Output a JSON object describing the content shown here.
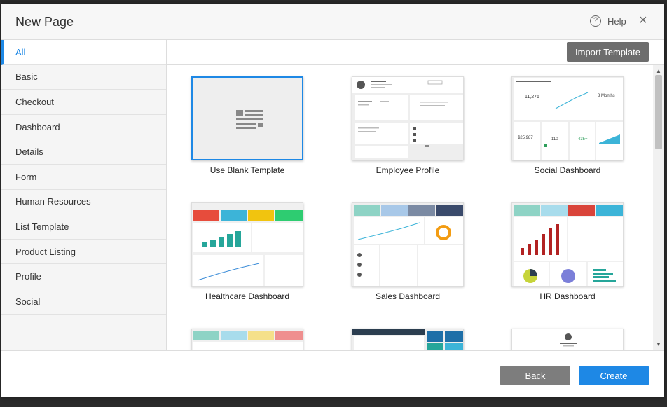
{
  "header": {
    "title": "New Page",
    "help_label": "Help",
    "help_icon": "?",
    "close_icon": "×"
  },
  "sidebar": {
    "items": [
      {
        "label": "All",
        "active": true
      },
      {
        "label": "Basic"
      },
      {
        "label": "Checkout"
      },
      {
        "label": "Dashboard"
      },
      {
        "label": "Details"
      },
      {
        "label": "Form"
      },
      {
        "label": "Human Resources"
      },
      {
        "label": "List Template"
      },
      {
        "label": "Product Listing"
      },
      {
        "label": "Profile"
      },
      {
        "label": "Social"
      }
    ]
  },
  "toolbar": {
    "import_label": "Import Template"
  },
  "templates": [
    {
      "label": "Use Blank Template",
      "selected": true
    },
    {
      "label": "Employee Profile"
    },
    {
      "label": "Social Dashboard"
    },
    {
      "label": "Healthcare Dashboard"
    },
    {
      "label": "Sales Dashboard"
    },
    {
      "label": "HR Dashboard"
    },
    {
      "label": ""
    },
    {
      "label": ""
    },
    {
      "label": ""
    }
  ],
  "footer": {
    "back_label": "Back",
    "create_label": "Create"
  },
  "colors": {
    "accent": "#1e88e5",
    "import_button": "#6d6d6d",
    "back_button": "#7d7d7d"
  }
}
